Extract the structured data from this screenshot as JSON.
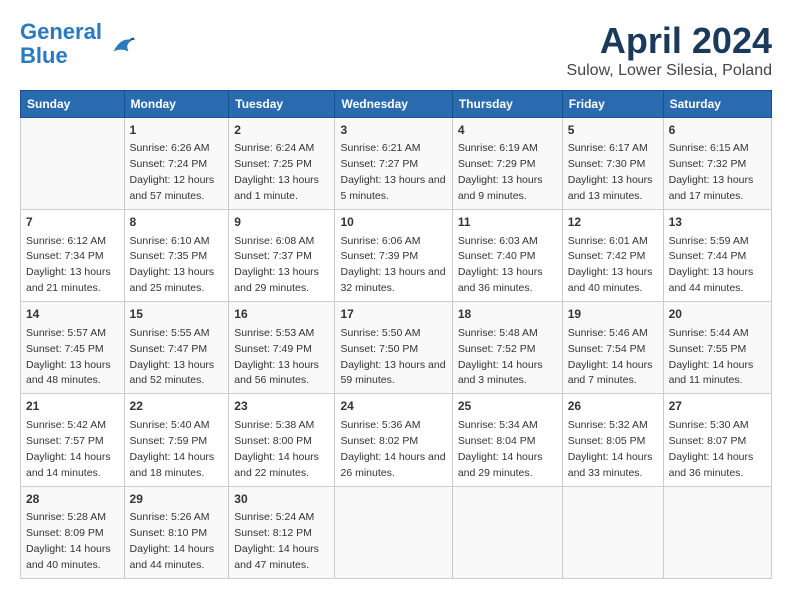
{
  "logo": {
    "line1": "General",
    "line2": "Blue"
  },
  "title": "April 2024",
  "subtitle": "Sulow, Lower Silesia, Poland",
  "days_of_week": [
    "Sunday",
    "Monday",
    "Tuesday",
    "Wednesday",
    "Thursday",
    "Friday",
    "Saturday"
  ],
  "weeks": [
    [
      {
        "num": "",
        "sunrise": "",
        "sunset": "",
        "daylight": ""
      },
      {
        "num": "1",
        "sunrise": "Sunrise: 6:26 AM",
        "sunset": "Sunset: 7:24 PM",
        "daylight": "Daylight: 12 hours and 57 minutes."
      },
      {
        "num": "2",
        "sunrise": "Sunrise: 6:24 AM",
        "sunset": "Sunset: 7:25 PM",
        "daylight": "Daylight: 13 hours and 1 minute."
      },
      {
        "num": "3",
        "sunrise": "Sunrise: 6:21 AM",
        "sunset": "Sunset: 7:27 PM",
        "daylight": "Daylight: 13 hours and 5 minutes."
      },
      {
        "num": "4",
        "sunrise": "Sunrise: 6:19 AM",
        "sunset": "Sunset: 7:29 PM",
        "daylight": "Daylight: 13 hours and 9 minutes."
      },
      {
        "num": "5",
        "sunrise": "Sunrise: 6:17 AM",
        "sunset": "Sunset: 7:30 PM",
        "daylight": "Daylight: 13 hours and 13 minutes."
      },
      {
        "num": "6",
        "sunrise": "Sunrise: 6:15 AM",
        "sunset": "Sunset: 7:32 PM",
        "daylight": "Daylight: 13 hours and 17 minutes."
      }
    ],
    [
      {
        "num": "7",
        "sunrise": "Sunrise: 6:12 AM",
        "sunset": "Sunset: 7:34 PM",
        "daylight": "Daylight: 13 hours and 21 minutes."
      },
      {
        "num": "8",
        "sunrise": "Sunrise: 6:10 AM",
        "sunset": "Sunset: 7:35 PM",
        "daylight": "Daylight: 13 hours and 25 minutes."
      },
      {
        "num": "9",
        "sunrise": "Sunrise: 6:08 AM",
        "sunset": "Sunset: 7:37 PM",
        "daylight": "Daylight: 13 hours and 29 minutes."
      },
      {
        "num": "10",
        "sunrise": "Sunrise: 6:06 AM",
        "sunset": "Sunset: 7:39 PM",
        "daylight": "Daylight: 13 hours and 32 minutes."
      },
      {
        "num": "11",
        "sunrise": "Sunrise: 6:03 AM",
        "sunset": "Sunset: 7:40 PM",
        "daylight": "Daylight: 13 hours and 36 minutes."
      },
      {
        "num": "12",
        "sunrise": "Sunrise: 6:01 AM",
        "sunset": "Sunset: 7:42 PM",
        "daylight": "Daylight: 13 hours and 40 minutes."
      },
      {
        "num": "13",
        "sunrise": "Sunrise: 5:59 AM",
        "sunset": "Sunset: 7:44 PM",
        "daylight": "Daylight: 13 hours and 44 minutes."
      }
    ],
    [
      {
        "num": "14",
        "sunrise": "Sunrise: 5:57 AM",
        "sunset": "Sunset: 7:45 PM",
        "daylight": "Daylight: 13 hours and 48 minutes."
      },
      {
        "num": "15",
        "sunrise": "Sunrise: 5:55 AM",
        "sunset": "Sunset: 7:47 PM",
        "daylight": "Daylight: 13 hours and 52 minutes."
      },
      {
        "num": "16",
        "sunrise": "Sunrise: 5:53 AM",
        "sunset": "Sunset: 7:49 PM",
        "daylight": "Daylight: 13 hours and 56 minutes."
      },
      {
        "num": "17",
        "sunrise": "Sunrise: 5:50 AM",
        "sunset": "Sunset: 7:50 PM",
        "daylight": "Daylight: 13 hours and 59 minutes."
      },
      {
        "num": "18",
        "sunrise": "Sunrise: 5:48 AM",
        "sunset": "Sunset: 7:52 PM",
        "daylight": "Daylight: 14 hours and 3 minutes."
      },
      {
        "num": "19",
        "sunrise": "Sunrise: 5:46 AM",
        "sunset": "Sunset: 7:54 PM",
        "daylight": "Daylight: 14 hours and 7 minutes."
      },
      {
        "num": "20",
        "sunrise": "Sunrise: 5:44 AM",
        "sunset": "Sunset: 7:55 PM",
        "daylight": "Daylight: 14 hours and 11 minutes."
      }
    ],
    [
      {
        "num": "21",
        "sunrise": "Sunrise: 5:42 AM",
        "sunset": "Sunset: 7:57 PM",
        "daylight": "Daylight: 14 hours and 14 minutes."
      },
      {
        "num": "22",
        "sunrise": "Sunrise: 5:40 AM",
        "sunset": "Sunset: 7:59 PM",
        "daylight": "Daylight: 14 hours and 18 minutes."
      },
      {
        "num": "23",
        "sunrise": "Sunrise: 5:38 AM",
        "sunset": "Sunset: 8:00 PM",
        "daylight": "Daylight: 14 hours and 22 minutes."
      },
      {
        "num": "24",
        "sunrise": "Sunrise: 5:36 AM",
        "sunset": "Sunset: 8:02 PM",
        "daylight": "Daylight: 14 hours and 26 minutes."
      },
      {
        "num": "25",
        "sunrise": "Sunrise: 5:34 AM",
        "sunset": "Sunset: 8:04 PM",
        "daylight": "Daylight: 14 hours and 29 minutes."
      },
      {
        "num": "26",
        "sunrise": "Sunrise: 5:32 AM",
        "sunset": "Sunset: 8:05 PM",
        "daylight": "Daylight: 14 hours and 33 minutes."
      },
      {
        "num": "27",
        "sunrise": "Sunrise: 5:30 AM",
        "sunset": "Sunset: 8:07 PM",
        "daylight": "Daylight: 14 hours and 36 minutes."
      }
    ],
    [
      {
        "num": "28",
        "sunrise": "Sunrise: 5:28 AM",
        "sunset": "Sunset: 8:09 PM",
        "daylight": "Daylight: 14 hours and 40 minutes."
      },
      {
        "num": "29",
        "sunrise": "Sunrise: 5:26 AM",
        "sunset": "Sunset: 8:10 PM",
        "daylight": "Daylight: 14 hours and 44 minutes."
      },
      {
        "num": "30",
        "sunrise": "Sunrise: 5:24 AM",
        "sunset": "Sunset: 8:12 PM",
        "daylight": "Daylight: 14 hours and 47 minutes."
      },
      {
        "num": "",
        "sunrise": "",
        "sunset": "",
        "daylight": ""
      },
      {
        "num": "",
        "sunrise": "",
        "sunset": "",
        "daylight": ""
      },
      {
        "num": "",
        "sunrise": "",
        "sunset": "",
        "daylight": ""
      },
      {
        "num": "",
        "sunrise": "",
        "sunset": "",
        "daylight": ""
      }
    ]
  ]
}
